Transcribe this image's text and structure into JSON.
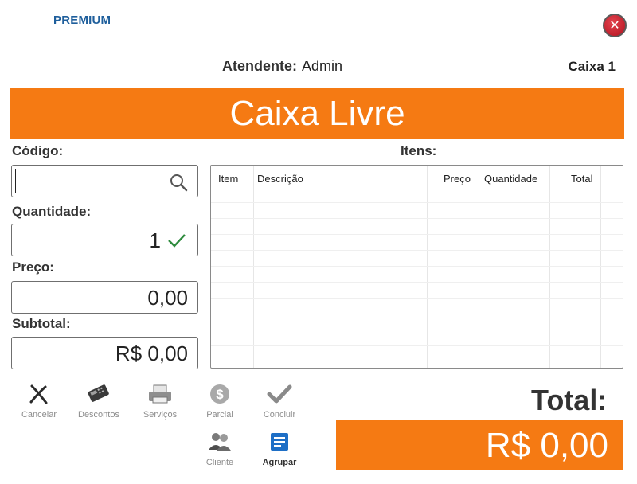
{
  "brand": "PREMIUM",
  "header": {
    "attendant_label": "Atendente:",
    "attendant_name": "Admin",
    "register": "Caixa 1"
  },
  "status_banner": "Caixa Livre",
  "form": {
    "code_label": "Código:",
    "code_value": "",
    "quantity_label": "Quantidade:",
    "quantity_value": "1",
    "price_label": "Preço:",
    "price_value": "0,00",
    "subtotal_label": "Subtotal:",
    "subtotal_value": "R$ 0,00"
  },
  "items": {
    "label": "Itens:",
    "columns": [
      "Item",
      "Descrição",
      "Preço",
      "Quantidade",
      "Total"
    ],
    "rows": []
  },
  "toolbar": [
    {
      "label": "Cancelar",
      "icon": "x-icon"
    },
    {
      "label": "Descontos",
      "icon": "card-machine-icon"
    },
    {
      "label": "Serviços",
      "icon": "printer-icon"
    },
    {
      "label": "Parcial",
      "icon": "dollar-coin-icon"
    },
    {
      "label": "Concluir",
      "icon": "checkmark-icon"
    },
    {
      "label": "Cliente",
      "icon": "clients-icon"
    },
    {
      "label": "Agrupar",
      "icon": "group-list-icon"
    }
  ],
  "total": {
    "label": "Total:",
    "value": "R$ 0,00"
  },
  "colors": {
    "accent": "#f57a13",
    "brand": "#1f5f9c",
    "close": "#c81e2c"
  }
}
